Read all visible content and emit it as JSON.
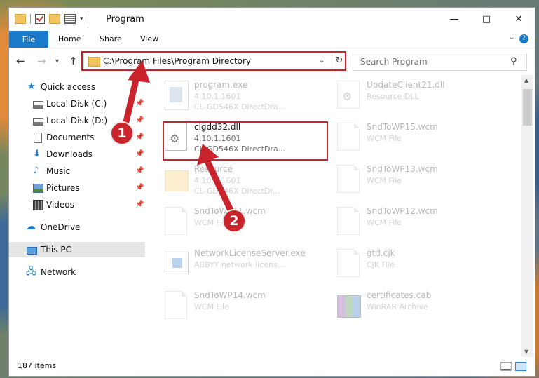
{
  "window": {
    "title": "Program",
    "controls": {
      "minimize": "—",
      "maximize": "□",
      "close": "✕"
    }
  },
  "ribbon": {
    "tabs": [
      {
        "label": "File"
      },
      {
        "label": "Home"
      },
      {
        "label": "Share"
      },
      {
        "label": "View"
      }
    ]
  },
  "address": {
    "path": "C:\\Program Files\\Program Directory",
    "search_placeholder": "Search Program"
  },
  "sidebar": {
    "items": [
      {
        "label": "Quick access"
      },
      {
        "label": "Local Disk (C:)"
      },
      {
        "label": "Local Disk (D:)"
      },
      {
        "label": "Documents"
      },
      {
        "label": "Downloads"
      },
      {
        "label": "Music"
      },
      {
        "label": "Pictures"
      },
      {
        "label": "Videos"
      },
      {
        "label": "OneDrive"
      },
      {
        "label": "This PC"
      },
      {
        "label": "Network"
      }
    ]
  },
  "files": [
    {
      "name": "program.exe",
      "line1": "4.10.1.1601",
      "line2": "CL-GD546X DirectDra...",
      "icon": "exe-icon"
    },
    {
      "name": "UpdateClient21.dll",
      "line1": "Resource DLL",
      "line2": "",
      "icon": "dll-icon"
    },
    {
      "name": "clgdd32.dll",
      "line1": "4.10.1.1601",
      "line2": "CL-GD546X DirectDra...",
      "icon": "dll-gear-icon"
    },
    {
      "name": "SndToWP15.wcm",
      "line1": "WCM File",
      "line2": "",
      "icon": "file-icon"
    },
    {
      "name": "Resource",
      "line1": "4.10.1.1601",
      "line2": "CL-GD546X DirectDr...",
      "icon": "folder-icon"
    },
    {
      "name": "SndToWP13.wcm",
      "line1": "WCM File",
      "line2": "",
      "icon": "file-icon"
    },
    {
      "name": "SndToWP11.wcm",
      "line1": "WCM File",
      "line2": "",
      "icon": "file-icon"
    },
    {
      "name": "SndToWP12.wcm",
      "line1": "WCM File",
      "line2": "",
      "icon": "file-icon"
    },
    {
      "name": "NetworkLicenseServer.exe",
      "line1": "ABBYY network licens...",
      "line2": "",
      "icon": "app-icon"
    },
    {
      "name": "gtd.cjk",
      "line1": "CJK File",
      "line2": "",
      "icon": "file-icon"
    },
    {
      "name": "SndToWP14.wcm",
      "line1": "WCM File",
      "line2": "",
      "icon": "file-icon"
    },
    {
      "name": "certificates.cab",
      "line1": "WinRAR Archive",
      "line2": "",
      "icon": "archive-icon"
    }
  ],
  "status": {
    "item_count": "187 items"
  },
  "annotations": {
    "step1": "1",
    "step2": "2",
    "highlight_color": "#c9242b"
  }
}
